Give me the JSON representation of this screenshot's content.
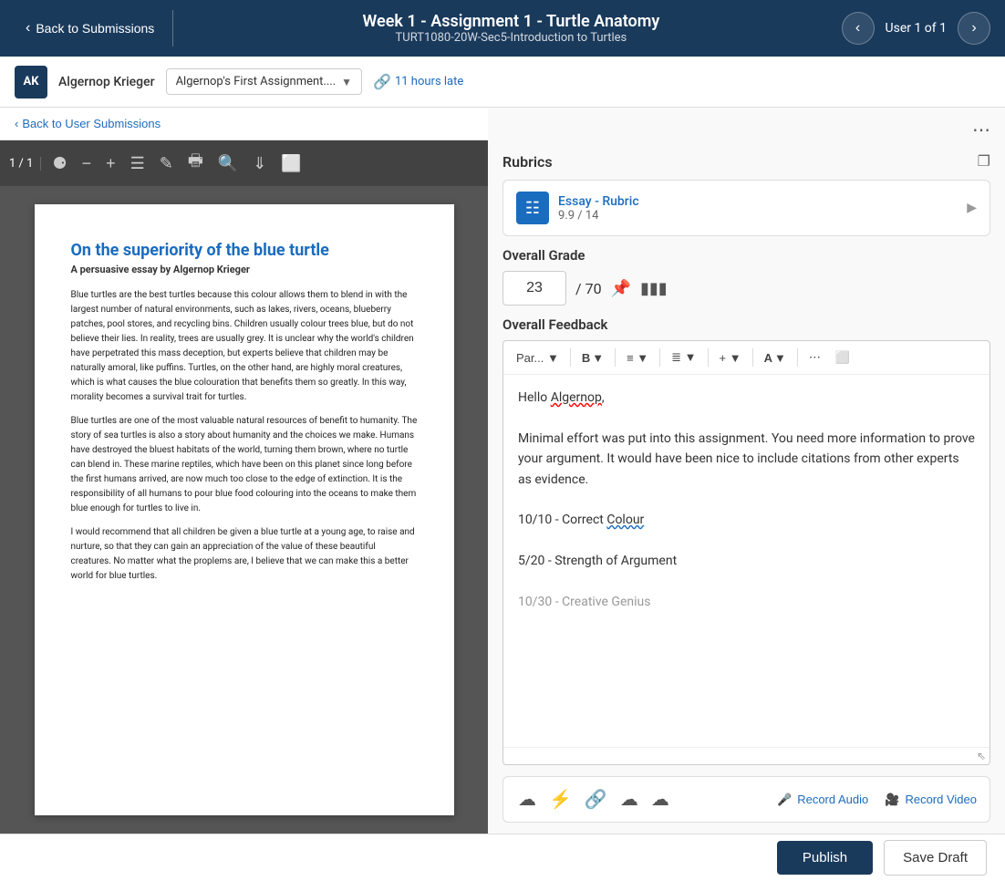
{
  "topNav": {
    "backLabel": "Back to Submissions",
    "assignmentTitle": "Week 1 - Assignment 1 - Turtle Anatomy",
    "courseCode": "TURT1080-20W-Sec5-Introduction to Turtles",
    "userCounter": "User 1 of 1"
  },
  "userBar": {
    "avatarInitials": "AK",
    "userName": "Algernop Krieger",
    "assignmentDropdown": "Algernop's First Assignment....",
    "lateLabel": "11 hours late"
  },
  "leftPanel": {
    "backToUserLabel": "Back to User Submissions",
    "pageCount": "1 / 1",
    "pdfTitle": "On the superiority of the blue turtle",
    "pdfSubtitle": "A persuasive essay by Algernop Krieger",
    "pdfParagraph1": "Blue turtles are the best turtles because this colour allows them to blend in with the largest number of natural environments, such as lakes, rivers, oceans, blueberry patches, pool stores, and recycling bins. Children usually colour trees blue, but do not believe their lies. In reality, trees are usually grey. It is unclear why the world's children have perpetrated this mass deception, but experts believe that children may be naturally amoral, like puffins. Turtles, on the other hand, are highly moral creatures, which is what causes the blue colouration that benefits them so greatly. In this way, morality becomes a survival trait for turtles.",
    "pdfParagraph2": "Blue turtles are one of the most valuable natural resources of benefit to humanity. The story of sea turtles is also a story about humanity and the choices we make. Humans have destroyed the bluest habitats of the world, turning them brown, where no turtle can blend in. These marine reptiles, which have been on this planet since long before the first humans arrived, are now much too close to the edge of extinction. It is the responsibility of all humans to pour blue food colouring into the oceans to make them blue enough for turtles to live in.",
    "pdfParagraph3": "I would recommend that all children be given a blue turtle at a young age, to raise and nurture, so that they can gain an appreciation of the value of these beautiful creatures. No matter what the proplems are, I believe that we can make this a better world for blue turtles."
  },
  "rightPanel": {
    "rubricsTitle": "Rubrics",
    "rubricName": "Essay - Rubric",
    "rubricScore": "9.9 / 14",
    "overallGradeLabel": "Overall Grade",
    "gradeValue": "23",
    "gradeTotal": "/ 70",
    "feedbackLabel": "Overall Feedback",
    "toolbarItems": [
      "Par...",
      "B",
      "↓",
      "≡",
      "↓",
      "≡",
      "↓",
      "+",
      "↓",
      "A",
      "↓",
      "..."
    ],
    "feedbackGreeting": "Hello Algernop,",
    "feedbackLine1": "Minimal effort was put into this assignment. You need more information to prove your argument. It would have been nice to include citations from other experts as evidence.",
    "feedbackLine2": "10/10 - Correct Colour",
    "feedbackLine3": "5/20 - Strength of Argument",
    "feedbackLine4": "10/30 - Creative Genius",
    "recordAudioLabel": "Record Audio",
    "recordVideoLabel": "Record Video"
  },
  "bottomBar": {
    "publishLabel": "Publish",
    "saveDraftLabel": "Save Draft"
  }
}
